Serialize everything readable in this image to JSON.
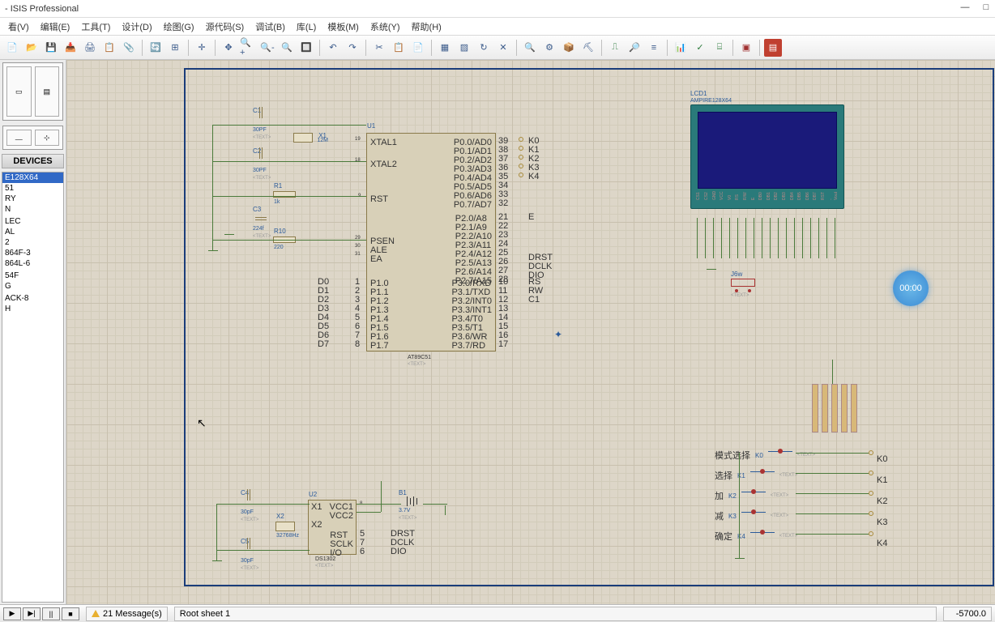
{
  "title": "- ISIS Professional",
  "menu": [
    "看(V)",
    "编辑(E)",
    "工具(T)",
    "设计(D)",
    "绘图(G)",
    "源代码(S)",
    "调试(B)",
    "库(L)",
    "模板(M)",
    "系统(Y)",
    "帮助(H)"
  ],
  "sidebar": {
    "header": "DEVICES"
  },
  "devices": [
    "E128X64",
    "51",
    "RY",
    "N",
    "",
    "LEC",
    "AL",
    "2",
    "864F-3",
    "864L-6",
    "",
    "54F",
    "G",
    "",
    "ACK-8",
    "H"
  ],
  "components": {
    "u1": {
      "ref": "U1",
      "val": "AT89C51",
      "text": "<TEXT>"
    },
    "u2": {
      "ref": "U2",
      "val": "DS1302",
      "text": "<TEXT>"
    },
    "lcd": {
      "ref": "LCD1",
      "val": "AMPIRE128X64"
    },
    "x1": {
      "ref": "X1",
      "val": "12M"
    },
    "x2": {
      "ref": "X2",
      "val": "32768Hz"
    },
    "c1": {
      "ref": "C1",
      "val": "30PF",
      "text": "<TEXT>"
    },
    "c2": {
      "ref": "C2",
      "val": "30PF",
      "text": "<TEXT>"
    },
    "c3": {
      "ref": "C3",
      "val": "224f",
      "text": "<TEXT>"
    },
    "c4": {
      "ref": "C4",
      "val": "30pF",
      "text": "<TEXT>"
    },
    "c5": {
      "ref": "C5",
      "val": "30pF",
      "text": "<TEXT>"
    },
    "r1": {
      "ref": "R1",
      "val": "1k",
      "text": "<TEXT>"
    },
    "r10": {
      "ref": "R10",
      "val": "220",
      "text": "<TEXT>"
    },
    "b1": {
      "ref": "B1",
      "val": "3.7V",
      "text": "<TEXT>"
    },
    "k0": {
      "ref": "K0",
      "text": "<TEXT>",
      "label": "模式选择"
    },
    "k1": {
      "ref": "K1",
      "text": "<TEXT>",
      "label": "选择"
    },
    "k2": {
      "ref": "K2",
      "text": "<TEXT>",
      "label": "加"
    },
    "k3": {
      "ref": "K3",
      "text": "<TEXT>",
      "label": "减"
    },
    "k4": {
      "ref": "K4",
      "text": "<TEXT>",
      "label": "确定"
    },
    "jsw": {
      "ref": "J6w",
      "text": "<TEXT>"
    }
  },
  "pins_u1_left_top": [
    "XTAL1",
    "XTAL2"
  ],
  "pins_u1_left_mid": [
    "RST"
  ],
  "pins_u1_left_bot": [
    "PSEN",
    "ALE",
    "EA"
  ],
  "pins_u1_p1": [
    "P1.0",
    "P1.1",
    "P1.2",
    "P1.3",
    "P1.4",
    "P1.5",
    "P1.6",
    "P1.7"
  ],
  "pins_u1_p0": [
    "P0.0/AD0",
    "P0.1/AD1",
    "P0.2/AD2",
    "P0.3/AD3",
    "P0.4/AD4",
    "P0.5/AD5",
    "P0.6/AD6",
    "P0.7/AD7"
  ],
  "pins_u1_p2": [
    "P2.0/A8",
    "P2.1/A9",
    "P2.2/A10",
    "P2.3/A11",
    "P2.4/A12",
    "P2.5/A13",
    "P2.6/A14",
    "P2.7/A15"
  ],
  "pins_u1_p3": [
    "P3.0/RXD",
    "P3.1/TXD",
    "P3.2/INT0",
    "P3.3/INT1",
    "P3.4/T0",
    "P3.5/T1",
    "P3.6/WR",
    "P3.7/RD"
  ],
  "nums_u1_left": [
    "19",
    "18",
    "9",
    "29",
    "30",
    "31"
  ],
  "nums_u1_p1": [
    "1",
    "2",
    "3",
    "4",
    "5",
    "6",
    "7",
    "8"
  ],
  "nums_u1_p0": [
    "39",
    "38",
    "37",
    "36",
    "35",
    "34",
    "33",
    "32"
  ],
  "nums_u1_p2": [
    "21",
    "22",
    "23",
    "24",
    "25",
    "26",
    "27",
    "28"
  ],
  "nums_u1_p3": [
    "10",
    "11",
    "12",
    "13",
    "14",
    "15",
    "16",
    "17"
  ],
  "nets_p0": [
    "K0",
    "K1",
    "K2",
    "K3",
    "K4"
  ],
  "nets_p2a": [
    "E"
  ],
  "nets_p2b": [
    "DRST",
    "DCLK",
    "DIO"
  ],
  "nets_p3": [
    "RS",
    "RW",
    "C1"
  ],
  "nets_d": [
    "D0",
    "D1",
    "D2",
    "D3",
    "D4",
    "D5",
    "D6",
    "D7"
  ],
  "pins_u2_left": [
    "X1",
    "",
    "X2"
  ],
  "pins_u2_right_top": [
    "VCC1",
    "VCC2"
  ],
  "pins_u2_right_bot": [
    "RST",
    "SCLK",
    "I/O"
  ],
  "nums_u2_left": [
    "8"
  ],
  "nums_u2_right": [
    "5",
    "7",
    "6"
  ],
  "nets_u2": [
    "DRST",
    "DCLK",
    "DIO"
  ],
  "nets_k": [
    "K0",
    "K1",
    "K2",
    "K3",
    "K4"
  ],
  "lcd_pins": [
    "CS1",
    "CS2",
    "GND",
    "VCC",
    "V0",
    "RS",
    "R/W",
    "E",
    "DB0",
    "DB1",
    "DB2",
    "DB3",
    "DB4",
    "DB5",
    "DB6",
    "DB7",
    "RST",
    "-Vout"
  ],
  "timer": "00:00",
  "status": {
    "messages": "21 Message(s)",
    "sheet": "Root sheet 1",
    "coord": "-5700.0"
  }
}
